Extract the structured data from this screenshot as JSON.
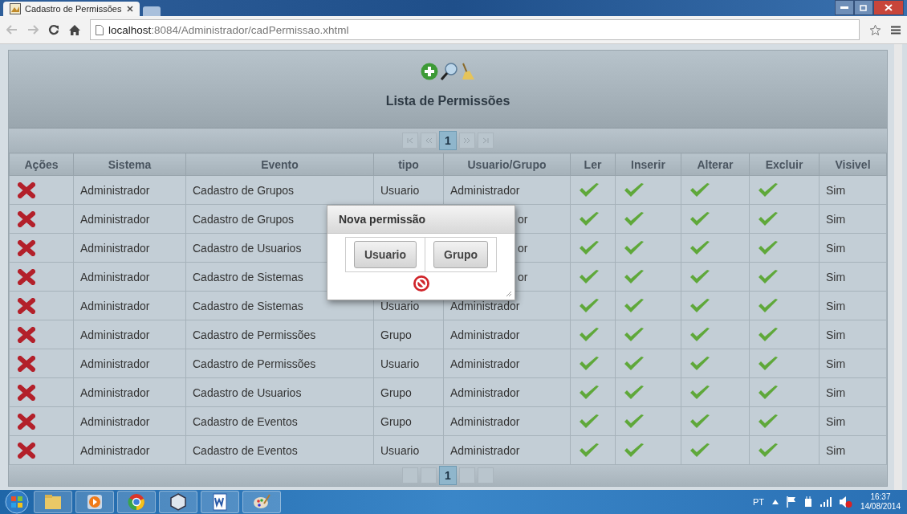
{
  "browser": {
    "tab_title": "Cadastro de Permissões",
    "url_host": "localhost",
    "url_path": ":8084/Administrador/cadPermissao.xhtml"
  },
  "panel": {
    "title": "Lista de Permissões"
  },
  "paginator": {
    "pages": [
      {
        "label": "1",
        "selected": true
      }
    ]
  },
  "table": {
    "columns": [
      "Ações",
      "Sistema",
      "Evento",
      "tipo",
      "Usuario/Grupo",
      "Ler",
      "Inserir",
      "Alterar",
      "Excluir",
      "Visivel"
    ],
    "rows": [
      {
        "sistema": "Administrador",
        "evento": "Cadastro de Grupos",
        "tipo": "Usuario",
        "usuario_grupo": "Administrador",
        "covered": false,
        "ler": true,
        "inserir": true,
        "alterar": true,
        "excluir": true,
        "visivel": "Sim"
      },
      {
        "sistema": "Administrador",
        "evento": "Cadastro de Grupos",
        "usuario_grupo": "or",
        "covered": true,
        "ler": true,
        "inserir": true,
        "alterar": true,
        "excluir": true,
        "visivel": "Sim"
      },
      {
        "sistema": "Administrador",
        "evento": "Cadastro de Usuarios",
        "usuario_grupo": "or",
        "covered": true,
        "ler": true,
        "inserir": true,
        "alterar": true,
        "excluir": true,
        "visivel": "Sim"
      },
      {
        "sistema": "Administrador",
        "evento": "Cadastro de Sistemas",
        "usuario_grupo": "or",
        "covered": true,
        "ler": true,
        "inserir": true,
        "alterar": true,
        "excluir": true,
        "visivel": "Sim"
      },
      {
        "sistema": "Administrador",
        "evento": "Cadastro de Sistemas",
        "tipo": "Usuario",
        "usuario_grupo": "Administrador",
        "covered": false,
        "ler": true,
        "inserir": true,
        "alterar": true,
        "excluir": true,
        "visivel": "Sim"
      },
      {
        "sistema": "Administrador",
        "evento": "Cadastro de Permissões",
        "tipo": "Grupo",
        "usuario_grupo": "Administrador",
        "covered": false,
        "ler": true,
        "inserir": true,
        "alterar": true,
        "excluir": true,
        "visivel": "Sim"
      },
      {
        "sistema": "Administrador",
        "evento": "Cadastro de Permissões",
        "tipo": "Usuario",
        "usuario_grupo": "Administrador",
        "covered": false,
        "ler": true,
        "inserir": true,
        "alterar": true,
        "excluir": true,
        "visivel": "Sim"
      },
      {
        "sistema": "Administrador",
        "evento": "Cadastro de Usuarios",
        "tipo": "Grupo",
        "usuario_grupo": "Administrador",
        "covered": false,
        "ler": true,
        "inserir": true,
        "alterar": true,
        "excluir": true,
        "visivel": "Sim"
      },
      {
        "sistema": "Administrador",
        "evento": "Cadastro de Eventos",
        "tipo": "Grupo",
        "usuario_grupo": "Administrador",
        "covered": false,
        "ler": true,
        "inserir": true,
        "alterar": true,
        "excluir": true,
        "visivel": "Sim"
      },
      {
        "sistema": "Administrador",
        "evento": "Cadastro de Eventos",
        "tipo": "Usuario",
        "usuario_grupo": "Administrador",
        "covered": false,
        "ler": true,
        "inserir": true,
        "alterar": true,
        "excluir": true,
        "visivel": "Sim"
      }
    ]
  },
  "bottom_paginator": {
    "pages": [
      {
        "label": "1",
        "selected": true
      }
    ]
  },
  "dialog": {
    "title": "Nova permissão",
    "buttons": [
      "Usuario",
      "Grupo"
    ]
  },
  "taskbar": {
    "language": "PT",
    "time": "16:37",
    "date": "14/08/2014"
  }
}
